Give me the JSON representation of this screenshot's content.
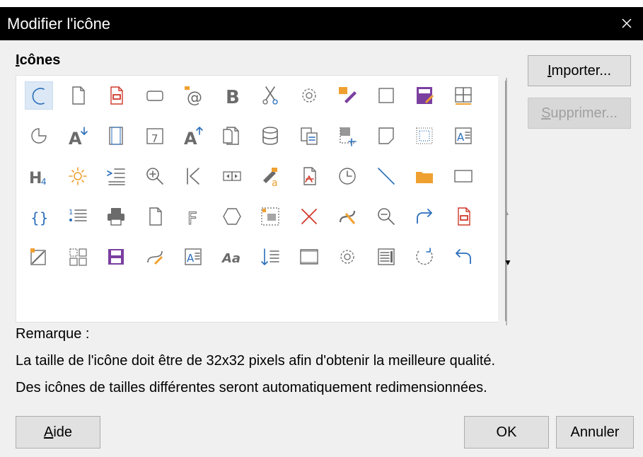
{
  "window": {
    "title": "Modifier l'icône"
  },
  "icons_section": {
    "label_prefix": "",
    "label_hotkey": "I",
    "label_rest": "cônes",
    "icons": [
      [
        "arc-icon",
        "document-icon",
        "fields-icon",
        "rounded-rect-icon",
        "mail-merge-icon",
        "bold-icon",
        "cut-icon",
        "settings-icon",
        "autocorrect-icon",
        "square-icon",
        "form-design-icon",
        "table-icon"
      ],
      [
        "pie-icon",
        "font-down-icon",
        "frame-icon",
        "date-icon",
        "font-up-icon",
        "pages-icon",
        "database-icon",
        "paste-icon",
        "image-crop-icon",
        "note-icon",
        "dotted-grid-icon",
        "text-box-icon"
      ],
      [
        "heading4-icon",
        "sun-icon",
        "indent-icon",
        "zoom-in-icon",
        "first-page-icon",
        "spin-icon",
        "format-paint-icon",
        "pdf-icon",
        "clock-icon",
        "line-icon",
        "folder-icon",
        "rectangle-icon"
      ],
      [
        "braces-icon",
        "numbered-list-icon",
        "printer-icon",
        "blank-page-icon",
        "font-f-icon",
        "hexagon-icon",
        "image-placeholder-icon",
        "delete-x-icon",
        "bezier-icon",
        "zoom-out-icon",
        "redo-icon",
        "field-doc-icon"
      ],
      [
        "edit-shape-icon",
        "page-layout-icon",
        "save-icon",
        "bezier-edit-icon",
        "text-frame-icon",
        "font-aa-icon",
        "sort-list-icon",
        "film-frame-icon",
        "gear-icon",
        "doc-columns-icon",
        "rotate-icon",
        "undo-icon"
      ]
    ]
  },
  "buttons": {
    "import_hotkey": "I",
    "import_rest": "mporter...",
    "delete_hotkey": "S",
    "delete_rest": "upprimer...",
    "help_hotkey": "A",
    "help_rest": "ide",
    "ok": "OK",
    "cancel": "Annuler"
  },
  "note": {
    "heading": "Remarque :",
    "line1": "La taille de l'icône doit être de 32x32 pixels afin d'obtenir la meilleure qualité.",
    "line2": "Des icônes de tailles différentes seront automatiquement redimensionnées."
  },
  "colors": {
    "blue": "#2a6ebb",
    "gray": "#6b6b6b",
    "red": "#d03a2b",
    "purple": "#7b3fa0",
    "orange": "#f0a030",
    "selected": "#dce8f5"
  }
}
